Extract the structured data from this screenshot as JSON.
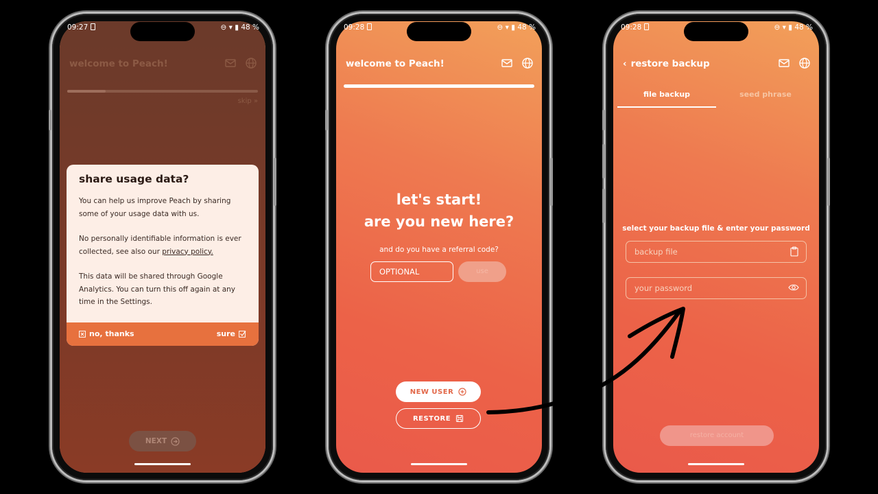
{
  "status": {
    "battery": "48 %"
  },
  "phone1": {
    "time": "09:27",
    "header_title": "welcome to Peach!",
    "progress_fraction": 0.2,
    "skip": "skip »",
    "modal": {
      "title": "share usage data?",
      "p1": "You can help us improve Peach by sharing some of your usage data with us.",
      "p2_prefix": "No personally identifiable information is ever collected, see also our ",
      "p2_link": "privacy policy.",
      "p3": "This data will be shared through Google Analytics. You can turn this off again at any time in the Settings.",
      "decline": "no, thanks",
      "accept": "sure"
    },
    "next_button": "NEXT"
  },
  "phone2": {
    "time": "09:28",
    "header_title": "welcome to Peach!",
    "headline1": "let's start!",
    "headline2": "are you new here?",
    "referral_question": "and do you have a referral code?",
    "referral_placeholder": "OPTIONAL",
    "use_button": "use",
    "new_user_button": "NEW USER",
    "restore_button": "RESTORE"
  },
  "phone3": {
    "time": "09:28",
    "header_title": "restore backup",
    "tabs": [
      "file backup",
      "seed phrase"
    ],
    "instruction": "select your backup file & enter your password",
    "backup_file_placeholder": "backup file",
    "password_placeholder": "your password",
    "restore_button": "restore account"
  },
  "colors": {
    "accent": "#e7713e",
    "gradient_top": "#f2a05a",
    "gradient_bottom": "#ea5a4a"
  }
}
